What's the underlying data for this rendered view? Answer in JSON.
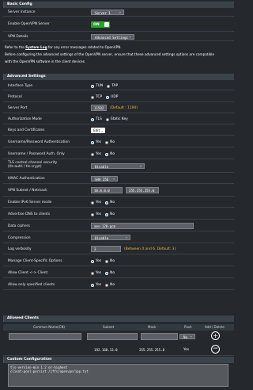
{
  "basic": {
    "header": "Basic Config",
    "server_instance_label": "Server instance",
    "server_instance_value": "Server 1",
    "enable_label": "Enable OpenVPN Server",
    "enable_value": "ON",
    "vpn_details_label": "VPN Details",
    "vpn_details_value": "Advanced Settings",
    "note1_prefix": "Refer to the ",
    "note1_link": "System Log",
    "note1_suffix": " for any error messages related to OpenVPN.",
    "note2a": "Before configuring the advanced settings of the OpenVPN server, ensure that these advanced settings options are compatible",
    "note2b": "with the OpenVPN software in the client devices."
  },
  "advanced": {
    "header": "Advanced Settings",
    "interface_label": "Interface Type",
    "interface_opt1": "TUN",
    "interface_opt2": "TAP",
    "protocol_label": "Protocol",
    "protocol_opt1": "TCP",
    "protocol_opt2": "UDP",
    "port_label": "Server Port",
    "port_value": "11582",
    "port_hint": "(Default : 1194)",
    "auth_label": "Authorization Mode",
    "auth_opt1": "TLS",
    "auth_opt2": "Static Key",
    "keys_label": "Keys and Certificates",
    "keys_button": "Edit...",
    "userpass_label": "Username/Password Authentication",
    "userpass_opt1": "Yes",
    "userpass_opt2": "No",
    "userpass_only_label": "Username / Password Auth. Only",
    "userpass_only_opt1": "Yes",
    "userpass_only_opt2": "No",
    "tls_label_1": "TLS control channel security",
    "tls_label_2": "(tls-auth / tls-crypt)",
    "tls_value": "Disable",
    "hmac_label": "HMAC Authentication",
    "hmac_value": "SHA 256",
    "subnet_label": "VPN Subnet / Netmask",
    "subnet_value": "10.8.0.0",
    "netmask_value": "255.255.255.0",
    "ipv6_label": "Enable IPv6 Server mode",
    "ipv6_opt1": "Yes",
    "ipv6_opt2": "No",
    "advertise_label": "Advertise DNS to clients",
    "advertise_opt1": "Yes",
    "advertise_opt2": "No",
    "ciphers_label": "Data ciphers",
    "ciphers_value": "aes-128-gcm",
    "compression_label": "Compression",
    "compression_value": "Disable",
    "verbosity_label": "Log verbosity",
    "verbosity_value": "3",
    "verbosity_hint": "(Between 0 and 6. Default: 3)",
    "manage_label": "Manage Client-Specific Options",
    "manage_opt1": "Yes",
    "manage_opt2": "No",
    "c2c_label": "Allow Client <-> Client",
    "c2c_opt1": "Yes",
    "c2c_opt2": "No",
    "only_specified_label": "Allow only specified clients",
    "only_specified_opt1": "Yes",
    "only_specified_opt2": "No"
  },
  "allowed": {
    "header": "Allowed Clients",
    "col_common": "Common Name(CN)",
    "col_subnet": "Subnet",
    "col_mask": "Mask",
    "col_push": "Push",
    "col_add": "Add / Delete",
    "new_push_value": "No",
    "row1_subnet": "192.168.13.0",
    "row1_mask": "255.255.255.0",
    "row1_push": "Yes"
  },
  "custom": {
    "header": "Custom Configuration",
    "text": "tls-version-min 1.2 or-highest\nclient-pool-persist /jffs/openvpn/ipp.txt"
  }
}
